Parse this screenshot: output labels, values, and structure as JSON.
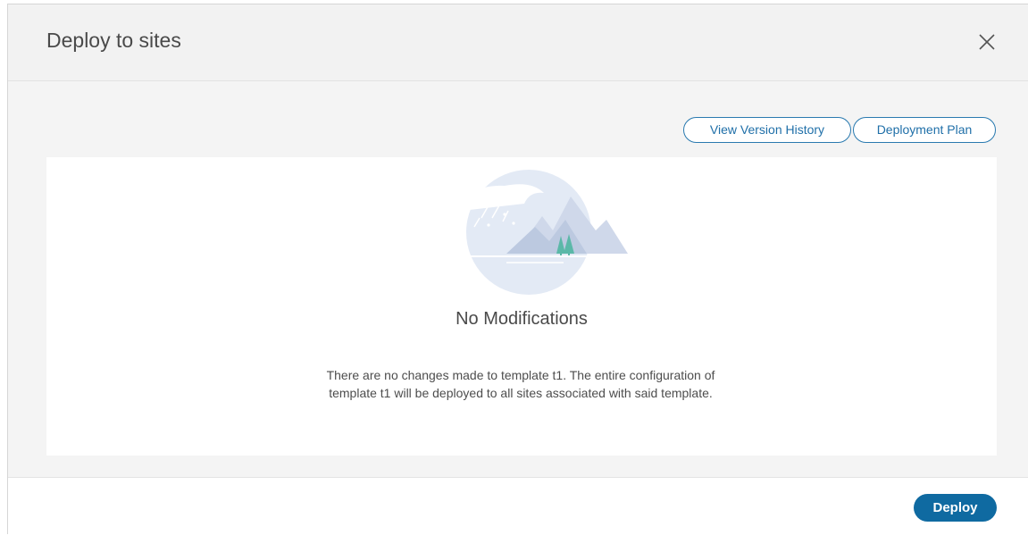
{
  "modal": {
    "title": "Deploy to sites",
    "close_icon": "close-icon"
  },
  "actions": {
    "view_version_history_label": "View Version History",
    "deployment_plan_label": "Deployment Plan"
  },
  "empty_state": {
    "illustration_icon": "mountain-rain-illustration",
    "title": "No Modifications",
    "description": "There are no changes made to template t1. The entire configuration of template t1 will be deployed to all sites associated with said template."
  },
  "footer": {
    "deploy_label": "Deploy"
  },
  "colors": {
    "accent": "#0f6aa1",
    "outline_button": "#2a7ab0"
  }
}
